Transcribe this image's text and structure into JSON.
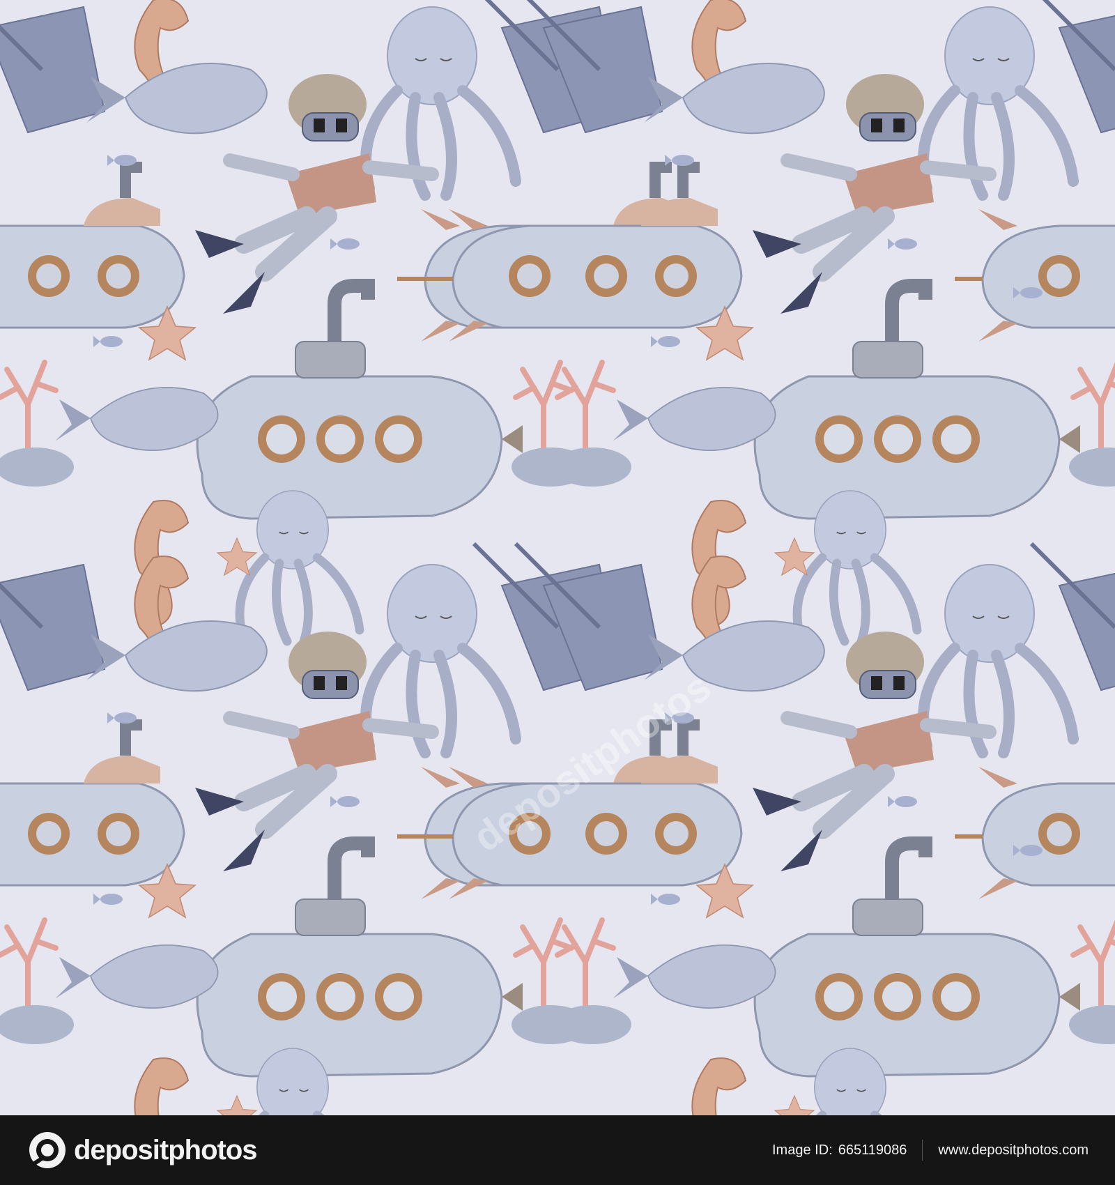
{
  "watermark": "depositphotos",
  "footer": {
    "brand": "depositphotos",
    "image_id_label": "Image ID:",
    "image_id": "665119086",
    "site": "www.depositphotos.com"
  },
  "colors": {
    "background": "#e6e6f1",
    "footer": "#151516"
  }
}
